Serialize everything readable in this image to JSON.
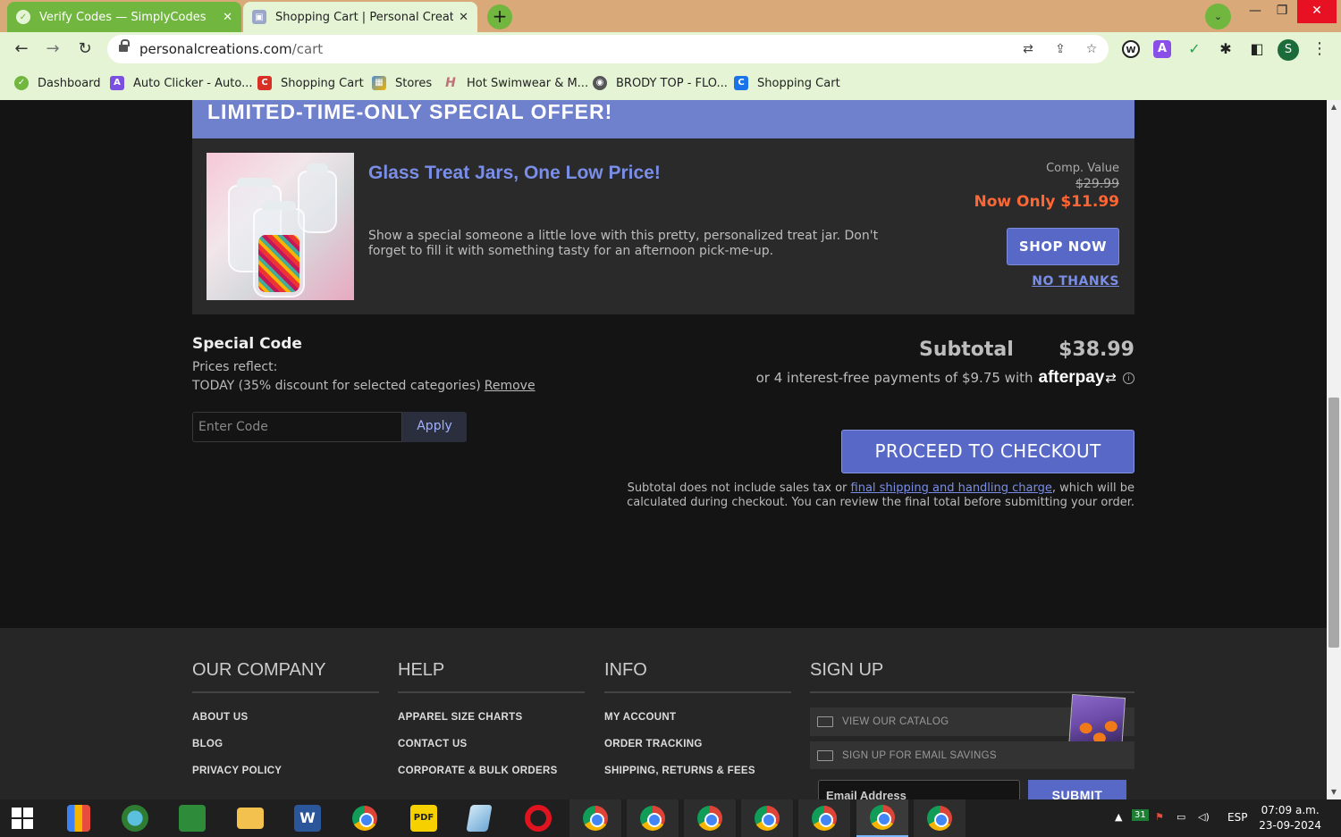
{
  "browser": {
    "tabs": [
      {
        "title": "Verify Codes — SimplyCodes",
        "active": false
      },
      {
        "title": "Shopping Cart | Personal Creatio",
        "active": true
      }
    ],
    "url_host": "personalcreations.com",
    "url_path": "/cart",
    "bookmarks": [
      {
        "label": "Dashboard",
        "icon": "simplycodes-icon",
        "color": "#71b63f"
      },
      {
        "label": "Auto Clicker - Auto...",
        "icon": "a-letter-icon",
        "color": "#7b4fe0"
      },
      {
        "label": "Shopping Cart",
        "icon": "c-letter-icon",
        "color": "#d93025"
      },
      {
        "label": "Stores",
        "icon": "stores-icon",
        "color": "#4a90d9"
      },
      {
        "label": "Hot Swimwear & M...",
        "icon": "h-logo-icon",
        "color": "#c0707a"
      },
      {
        "label": "BRODY TOP - FLO...",
        "icon": "globe-icon",
        "color": "#555555"
      },
      {
        "label": "Shopping Cart",
        "icon": "c-square-icon",
        "color": "#1a73e8"
      }
    ],
    "profile_initial": "S"
  },
  "offer": {
    "banner": "LIMITED-TIME-ONLY SPECIAL OFFER!",
    "title": "Glass Treat Jars, One Low Price!",
    "description": "Show a special someone a little love with this pretty, personalized treat jar. Don't forget to fill it with something tasty for an afternoon pick-me-up.",
    "comp_label": "Comp. Value",
    "comp_price": "$29.99",
    "now_price": "Now Only $11.99",
    "shop_now": "SHOP NOW",
    "no_thanks": "NO THANKS",
    "accent": "#6f80cc",
    "price_color": "#ff6633"
  },
  "special_code": {
    "title": "Special Code",
    "prices_reflect": "Prices reflect:",
    "discount_text": "TODAY (35% discount for selected categories)",
    "remove": "Remove",
    "input_placeholder": "Enter Code",
    "apply": "Apply"
  },
  "summary": {
    "subtotal_label": "Subtotal",
    "subtotal_value": "$38.99",
    "afterpay_text": "or 4 interest-free payments of $9.75 with",
    "afterpay_logo": "afterpay",
    "checkout": "PROCEED TO CHECKOUT",
    "note_before": "Subtotal does not include sales tax or ",
    "note_link": "final shipping and handling charge",
    "note_after": ", which will be calculated during checkout. You can review the final total before submitting your order."
  },
  "footer": {
    "company": {
      "heading": "OUR COMPANY",
      "links": [
        "ABOUT US",
        "BLOG",
        "PRIVACY POLICY"
      ]
    },
    "help": {
      "heading": "HELP",
      "links": [
        "APPAREL SIZE CHARTS",
        "CONTACT US",
        "CORPORATE & BULK ORDERS"
      ]
    },
    "info": {
      "heading": "INFO",
      "links": [
        "MY ACCOUNT",
        "ORDER TRACKING",
        "SHIPPING, RETURNS & FEES"
      ]
    },
    "signup": {
      "heading": "SIGN UP",
      "catalog": "VIEW OUR CATALOG",
      "email_savings": "SIGN UP FOR EMAIL SAVINGS",
      "email_placeholder": "Email Address",
      "submit": "SUBMIT"
    }
  },
  "taskbar": {
    "time": "07:09 a.m.",
    "date": "23-09-2024",
    "language": "ESP",
    "calendar_badge": "31"
  }
}
